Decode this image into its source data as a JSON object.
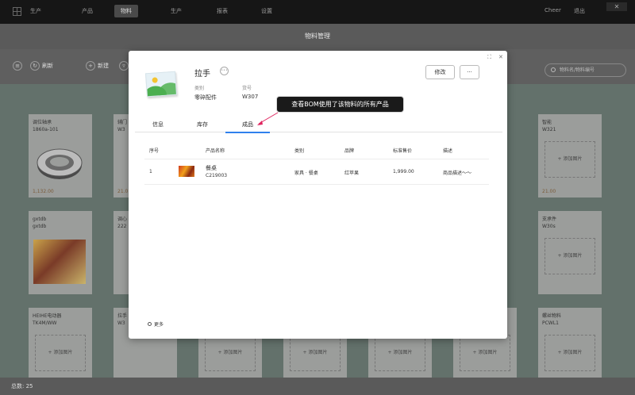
{
  "topnav": {
    "brand": "生产",
    "items": [
      "产品",
      "物料",
      "生产",
      "报表",
      "设置"
    ],
    "active_index": 1,
    "user": "Cheer",
    "logout": "退出",
    "close_glyph": "✕"
  },
  "page": {
    "title": "物料管理"
  },
  "toolbar": {
    "refresh": "刷新",
    "new": "新建",
    "search_placeholder": "物料名/物料编号"
  },
  "cards": [
    {
      "name": "调位轴承",
      "code": "1860a-101",
      "price": "1,132.00",
      "image": "bearing"
    },
    {
      "name": "gxtdb",
      "code": "gxtdb",
      "price": "",
      "image": "painting"
    },
    {
      "name": "HEIHE电动器",
      "code": "TK4M/WW",
      "price": "",
      "image": "add"
    },
    {
      "name": "智能",
      "code": "W321",
      "price": "21.00",
      "image": "add"
    },
    {
      "name": "支承件",
      "code": "W30s",
      "price": "",
      "image": "add"
    },
    {
      "name": "螺丝物料",
      "code": "PCWL1",
      "price": "",
      "image": "add"
    }
  ],
  "partial_card_texts": [
    "辅门",
    "W3",
    "21.0",
    "调心",
    "222",
    "拉手",
    "W3"
  ],
  "add_image_label": "+ 添加图片",
  "statusbar": {
    "total_label": "总数:",
    "total": "25"
  },
  "modal": {
    "title": "拉手",
    "category_label": "类别",
    "category_value": "零碎配件",
    "code_label": "货号",
    "code_value": "W307",
    "edit_button": "修改",
    "more_button": "···",
    "window_controls": {
      "expand": "⛶",
      "close": "✕"
    },
    "tabs": [
      {
        "label": "信息"
      },
      {
        "label": "库存"
      },
      {
        "label": "成品"
      }
    ],
    "active_tab": 2,
    "tooltip": "查看BOM使用了该物料的所有产品",
    "table": {
      "headers": [
        "序号",
        "产品名称",
        "类别",
        "品牌",
        "标准售价",
        "描述"
      ],
      "rows": [
        {
          "index": "1",
          "name": "餐桌",
          "code": "C219003",
          "category": "家具 · 餐桌",
          "brand": "红苹果",
          "price": "1,999.00",
          "desc": "商品描述～～"
        }
      ]
    },
    "more_link": "更多"
  },
  "colors": {
    "accent": "#2f80ed",
    "topnav_bg": "#161616",
    "overlay_bg": "#63716b"
  }
}
